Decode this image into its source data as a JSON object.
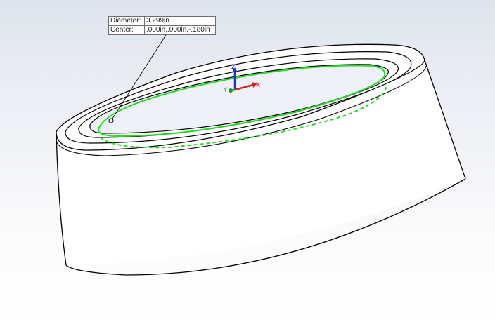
{
  "readout": {
    "diameter_label": "Diameter:",
    "diameter_value": "3.299in",
    "center_label": "Center:",
    "center_value": ".000in,.000in,-.180in"
  },
  "triad": {
    "z_label": "Z",
    "y_label": "Y",
    "x_label": "X"
  },
  "colors": {
    "viewport_top": "#dfe4ed",
    "viewport_bottom": "#ffffff",
    "model_edges": "#000000",
    "selection_highlight": "#22dd22",
    "axis_x": "#d42020",
    "axis_y": "#1a9a1a",
    "axis_z": "#2030c8"
  },
  "icons": {
    "triad": "reference-triad-icon",
    "edge_point": "edge-point-marker-icon"
  }
}
